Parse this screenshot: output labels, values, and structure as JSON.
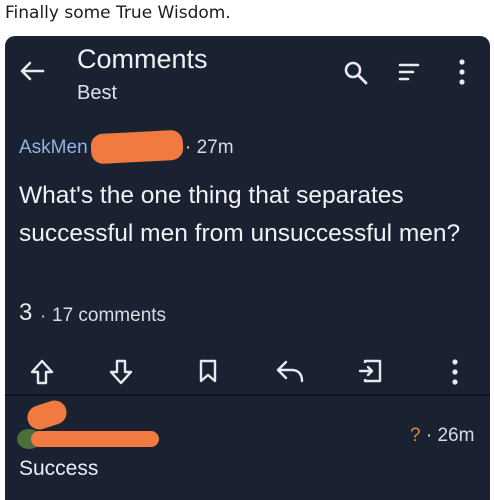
{
  "caption": "Finally some True Wisdom.",
  "header": {
    "title": "Comments",
    "sort": "Best",
    "icons": [
      "back-arrow-icon",
      "search-icon",
      "filter-icon",
      "more-vertical-icon"
    ]
  },
  "post": {
    "subreddit": "AskMen",
    "age": "27m",
    "question": "What's the one thing that separates successful men from unsuccessful men?",
    "votes": "3",
    "separator": "·",
    "comments": "17 comments"
  },
  "actions": [
    "upvote-icon",
    "downvote-icon",
    "bookmark-icon",
    "reply-icon",
    "share-icon",
    "more-vertical-icon"
  ],
  "reply": {
    "flair": "?",
    "separator": "·",
    "age": "26m",
    "body": "Success"
  },
  "colors": {
    "background": "#1a2130",
    "subreddit": "#8fb4e6",
    "redaction": "#f07a3f",
    "flair": "#d98a3c"
  }
}
